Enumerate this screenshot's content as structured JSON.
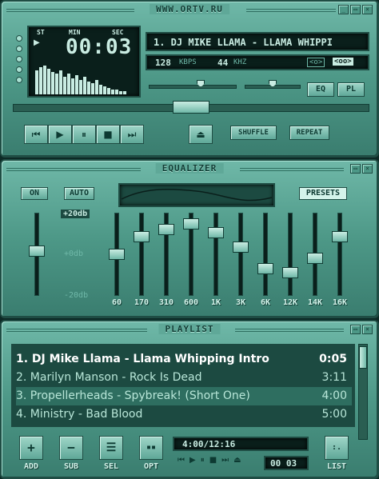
{
  "player": {
    "title": "WWW.ORTV.RU",
    "indicators": {
      "stereo": "ST",
      "minutes": "MIN",
      "seconds": "SEC"
    },
    "time": "00:03",
    "marquee": "1. DJ MIKE LLAMA - LLAMA WHIPPI",
    "bitrate": "128",
    "bitrate_unit": "KBPS",
    "samplerate": "44",
    "samplerate_unit": "KHZ",
    "mono_label": "<o>",
    "stereo_label": "<oo>",
    "eq_label": "EQ",
    "pl_label": "PL",
    "shuffle_label": "SHUFFLE",
    "repeat_label": "REPEAT",
    "volume_level": 0.6,
    "balance_level": 0.5,
    "seek_level": 0.5
  },
  "equalizer": {
    "title": "EQUALIZER",
    "on_label": "ON",
    "auto_label": "AUTO",
    "presets_label": "PRESETS",
    "db_top": "+20db",
    "db_mid": "+0db",
    "db_bottom": "-20db",
    "preamp_level": 0.55,
    "bands": [
      {
        "label": "60",
        "level": 0.5
      },
      {
        "label": "170",
        "level": 0.75
      },
      {
        "label": "310",
        "level": 0.85
      },
      {
        "label": "600",
        "level": 0.92
      },
      {
        "label": "1K",
        "level": 0.8
      },
      {
        "label": "3K",
        "level": 0.6
      },
      {
        "label": "6K",
        "level": 0.3
      },
      {
        "label": "12K",
        "level": 0.25
      },
      {
        "label": "14K",
        "level": 0.45
      },
      {
        "label": "16K",
        "level": 0.75
      }
    ]
  },
  "playlist": {
    "title": "PLAYLIST",
    "tracks": [
      {
        "title": "1. DJ Mike Llama - Llama Whipping Intro",
        "duration": "0:05"
      },
      {
        "title": "2. Marilyn Manson - Rock Is Dead",
        "duration": "3:11"
      },
      {
        "title": "3. Propellerheads - Spybreak! (Short One)",
        "duration": "4:00"
      },
      {
        "title": "4. Ministry - Bad Blood",
        "duration": "5:00"
      }
    ],
    "total_time": "4:00/12:16",
    "mini_time": "00 03",
    "buttons": {
      "add": "ADD",
      "sub": "SUB",
      "sel": "SEL",
      "opt": "OPT",
      "list": "LIST"
    }
  },
  "colors": {
    "accent": "#4d9887",
    "lcd": "#0a1f1b",
    "lcd_text": "#c9ece2"
  }
}
